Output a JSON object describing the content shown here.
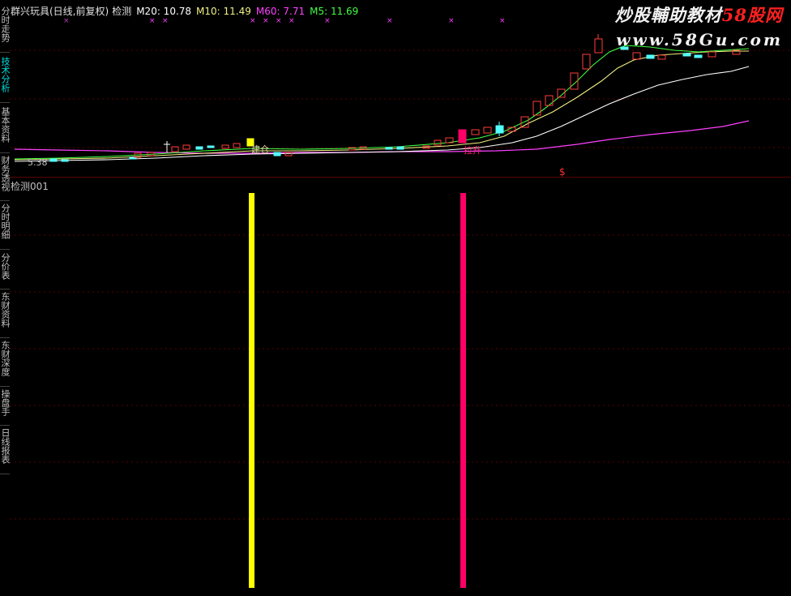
{
  "sidebar": {
    "tabs": [
      {
        "label": "分时走势",
        "active": false
      },
      {
        "label": "技术分析",
        "active": true
      },
      {
        "label": "基本资料",
        "active": false
      },
      {
        "label": "财务透视",
        "active": false
      },
      {
        "label": "分时明细",
        "active": false
      },
      {
        "label": "分价表",
        "active": false
      },
      {
        "label": "东财资料",
        "active": false
      },
      {
        "label": "东财深度",
        "active": false
      },
      {
        "label": "操盘手",
        "active": false
      },
      {
        "label": "日线报表",
        "active": false
      }
    ]
  },
  "header": {
    "title": "群兴玩具(日线,前复权)",
    "indicator": "检测",
    "ma20": "M20: 10.78",
    "ma10": "M10: 11.49",
    "ma60": "M60: 7.71",
    "ma5": "M5: 11.69"
  },
  "watermark": {
    "line1_a": "炒股輔助教材",
    "line1_b": "58股网",
    "line2": "www.58Gu.com"
  },
  "chart_labels": {
    "low_price": "5.38",
    "buy_label": "建仓",
    "signal_label": "拉升",
    "dollar_marker": "$"
  },
  "sub_panel": {
    "label": "检测001"
  },
  "colors": {
    "background": "#000000",
    "up_candle": "#ff3c3c",
    "down_candle": "#54ffff",
    "ma5": "#ffffff",
    "ma10": "#f0f080",
    "ma20": "#40ff40",
    "ma60": "#ff40ff",
    "yellow_bar": "#ffff00",
    "pink_bar": "#ff0066",
    "grid": "#5a0000"
  }
}
